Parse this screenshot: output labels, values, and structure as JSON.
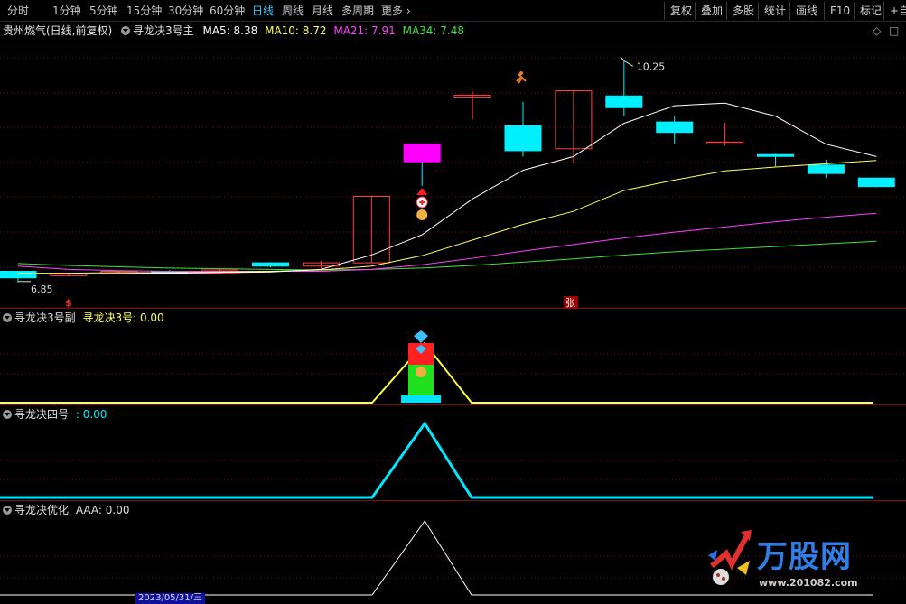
{
  "toolbar": {
    "periods": [
      "分时",
      "1分钟",
      "5分钟",
      "15分钟",
      "30分钟",
      "60分钟",
      "日线",
      "周线",
      "月线",
      "多周期",
      "更多"
    ],
    "active_period": "日线",
    "right_buttons": [
      "复权",
      "叠加",
      "多股",
      "统计",
      "画线",
      "F10",
      "标记",
      "+自"
    ]
  },
  "main_panel": {
    "stock_title": "贵州燃气(日线,前复权)",
    "indicator_name": "寻龙决3号主",
    "ma5": "MA5: 8.38",
    "ma10": "MA10: 8.72",
    "ma21": "MA21: 7.91",
    "ma34": "MA34: 7.48",
    "high_label": "10.25",
    "low_label": "6.85",
    "signal_dollar": "$",
    "signal_zhang": "张"
  },
  "sub1": {
    "name": "寻龙决3号副",
    "value_label": "寻龙决3号: 0.00"
  },
  "sub2": {
    "name": "寻龙决四号",
    "value_label": ": 0.00"
  },
  "sub3": {
    "name": "寻龙决优化",
    "value_label": "AAA: 0.00"
  },
  "bottom": {
    "date": "2023/05/31/三"
  },
  "watermark": {
    "brand": "万股网",
    "url": "www.201082.com"
  },
  "colors": {
    "up": "#ff4040",
    "down": "#00f0ff",
    "ma5": "#ffffff",
    "ma10": "#ffff60",
    "ma21": "#ff40ff",
    "ma34": "#40e040",
    "grid": "#7a1010",
    "active": "#3ec8ff"
  },
  "chart_data": {
    "type": "candlestick",
    "candles": [
      {
        "o": 7.02,
        "h": 7.02,
        "l": 6.85,
        "c": 6.92
      },
      {
        "o": 6.96,
        "h": 7.0,
        "l": 6.94,
        "c": 6.98
      },
      {
        "o": 7.0,
        "h": 7.04,
        "l": 6.97,
        "c": 7.02
      },
      {
        "o": 7.02,
        "h": 7.04,
        "l": 6.98,
        "c": 6.99
      },
      {
        "o": 6.98,
        "h": 7.06,
        "l": 6.97,
        "c": 7.04
      },
      {
        "o": 7.15,
        "h": 7.16,
        "l": 7.08,
        "c": 7.1
      },
      {
        "o": 7.1,
        "h": 7.18,
        "l": 7.05,
        "c": 7.15
      },
      {
        "o": 7.15,
        "h": 8.17,
        "l": 7.15,
        "c": 8.17
      },
      {
        "o": 8.97,
        "h": 8.97,
        "l": 8.33,
        "c": 8.7
      },
      {
        "o": 9.72,
        "h": 9.78,
        "l": 9.35,
        "c": 9.72
      },
      {
        "o": 9.25,
        "h": 9.62,
        "l": 8.78,
        "c": 8.87
      },
      {
        "o": 8.9,
        "h": 9.79,
        "l": 8.68,
        "c": 9.79
      },
      {
        "o": 9.71,
        "h": 10.25,
        "l": 9.4,
        "c": 9.53
      },
      {
        "o": 9.31,
        "h": 9.4,
        "l": 8.98,
        "c": 9.15
      },
      {
        "o": 8.98,
        "h": 9.3,
        "l": 8.95,
        "c": 9.0
      },
      {
        "o": 8.81,
        "h": 8.82,
        "l": 8.63,
        "c": 8.79
      },
      {
        "o": 8.65,
        "h": 8.73,
        "l": 8.45,
        "c": 8.52
      },
      {
        "o": 8.45,
        "h": 8.45,
        "l": 8.31,
        "c": 8.32
      }
    ],
    "ma5": [
      null,
      6.98,
      6.98,
      6.99,
      7.0,
      7.01,
      7.05,
      7.27,
      7.58,
      8.13,
      8.57,
      8.78,
      9.29,
      9.56,
      9.6,
      9.4,
      8.97,
      8.78
    ],
    "ma10": [
      6.99,
      6.99,
      7.0,
      7.0,
      7.01,
      7.02,
      7.04,
      7.1,
      7.26,
      7.5,
      7.74,
      7.94,
      8.26,
      8.42,
      8.56,
      8.62,
      8.67,
      8.72
    ],
    "ma21": [
      7.1,
      7.05,
      7.03,
      7.02,
      7.02,
      7.02,
      7.02,
      7.05,
      7.12,
      7.22,
      7.33,
      7.43,
      7.53,
      7.62,
      7.7,
      7.78,
      7.85,
      7.91
    ],
    "ma34": [
      7.14,
      7.11,
      7.09,
      7.07,
      7.06,
      7.05,
      7.04,
      7.05,
      7.07,
      7.11,
      7.16,
      7.21,
      7.27,
      7.32,
      7.36,
      7.4,
      7.44,
      7.48
    ],
    "ylim": [
      6.75,
      10.6
    ],
    "sub1_values": [
      0,
      0,
      0,
      0,
      0,
      0,
      0,
      0,
      1,
      0,
      0,
      0,
      0,
      0,
      0,
      0,
      0,
      0
    ],
    "sub2_values": [
      0,
      0,
      0,
      0,
      0,
      0,
      0,
      0,
      1,
      0,
      0,
      0,
      0,
      0,
      0,
      0,
      0,
      0
    ],
    "sub3_values": [
      0,
      0,
      0,
      0,
      0,
      0,
      0,
      0,
      1,
      0,
      0,
      0,
      0,
      0,
      0,
      0,
      0,
      0
    ]
  }
}
